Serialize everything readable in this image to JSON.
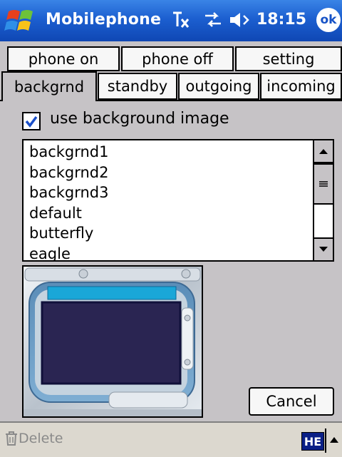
{
  "titlebar": {
    "title": "Mobilephone",
    "time": "18:15",
    "ok_label": "ok",
    "icons": [
      "windows-start-icon",
      "text-input-icon",
      "connectivity-icon",
      "speaker-icon"
    ]
  },
  "tabs_top": [
    {
      "label": "phone on"
    },
    {
      "label": "phone off"
    },
    {
      "label": "setting"
    }
  ],
  "tabs_bottom": [
    {
      "label": "backgrnd",
      "active": true
    },
    {
      "label": "standby"
    },
    {
      "label": "outgoing"
    },
    {
      "label": "incoming"
    }
  ],
  "background_panel": {
    "use_image_label": "use background image",
    "use_image_checked": true,
    "list_items": [
      "backgrnd1",
      "backgrnd2",
      "backgrnd3",
      "default",
      "butterfly",
      "eagle"
    ],
    "cancel_label": "Cancel"
  },
  "menubar": {
    "delete_label": "Delete",
    "input_lang": "HE"
  },
  "colors": {
    "title_bar": "#1c5fd0",
    "background": "#c6c3c6",
    "preview_screen": "#2a2552",
    "preview_highlight": "#1aa7d8"
  }
}
